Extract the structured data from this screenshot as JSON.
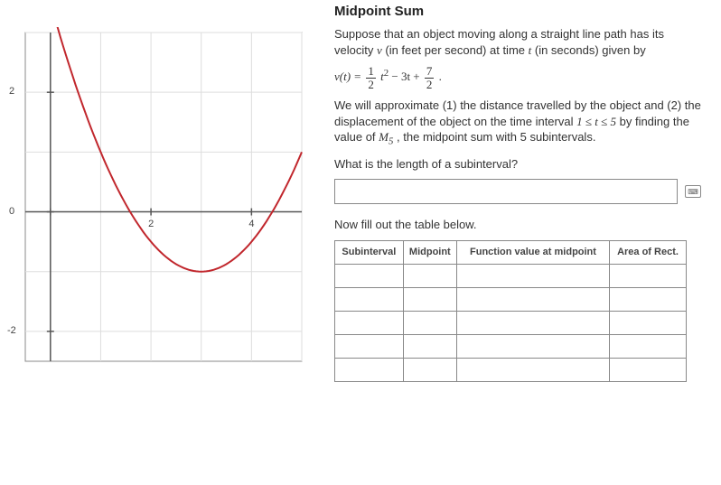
{
  "title": "Midpoint Sum",
  "problem": {
    "intro_a": "Suppose that an object moving along a straight line path has its velocity ",
    "v_sym": "v",
    "intro_b": " (in feet per second) at time ",
    "t_sym": "t",
    "intro_c": " (in seconds) given by",
    "eq_lhs": "v(t) = ",
    "eq_frac1_num": "1",
    "eq_frac1_den": "2",
    "eq_mid_a": "t",
    "eq_mid_sup": "2",
    "eq_mid_b": " − 3t + ",
    "eq_frac2_num": "7",
    "eq_frac2_den": "2",
    "eq_tail": " .",
    "para2_a": "We will approximate (1) the distance travelled by the object and (2) the displacement of the object on the time interval ",
    "interval": "1 ≤ t ≤ 5",
    "para2_b": " by finding the value of ",
    "Msym": "M",
    "Msub": "5",
    "para2_c": " , the midpoint sum with 5 subintervals.",
    "question1": "What is the length of a subinterval?",
    "answer_placeholder": "",
    "table_prompt": "Now fill out the table below."
  },
  "table": {
    "headers": [
      "Subinterval",
      "Midpoint",
      "Function value at midpoint",
      "Area of Rect."
    ],
    "rows": [
      [
        "",
        "",
        "",
        ""
      ],
      [
        "",
        "",
        "",
        ""
      ],
      [
        "",
        "",
        "",
        ""
      ],
      [
        "",
        "",
        "",
        ""
      ],
      [
        "",
        "",
        "",
        ""
      ]
    ]
  },
  "chart_data": {
    "type": "line",
    "title": "",
    "xlabel": "",
    "ylabel": "",
    "xlim": [
      -0.5,
      5
    ],
    "ylim": [
      -2.5,
      3
    ],
    "xticks": [
      0,
      2,
      4
    ],
    "yticks": [
      -2,
      0,
      2
    ],
    "series": [
      {
        "name": "v(t)=0.5t^2-3t+3.5",
        "color": "#c1272d",
        "x": [
          -0.5,
          0,
          0.5,
          1,
          1.5,
          2,
          2.5,
          3,
          3.5,
          4,
          4.5,
          5
        ],
        "y": [
          5.125,
          3.5,
          2.125,
          1,
          0.125,
          -0.5,
          -0.875,
          -1,
          -0.875,
          -0.5,
          0.125,
          1
        ]
      }
    ]
  }
}
